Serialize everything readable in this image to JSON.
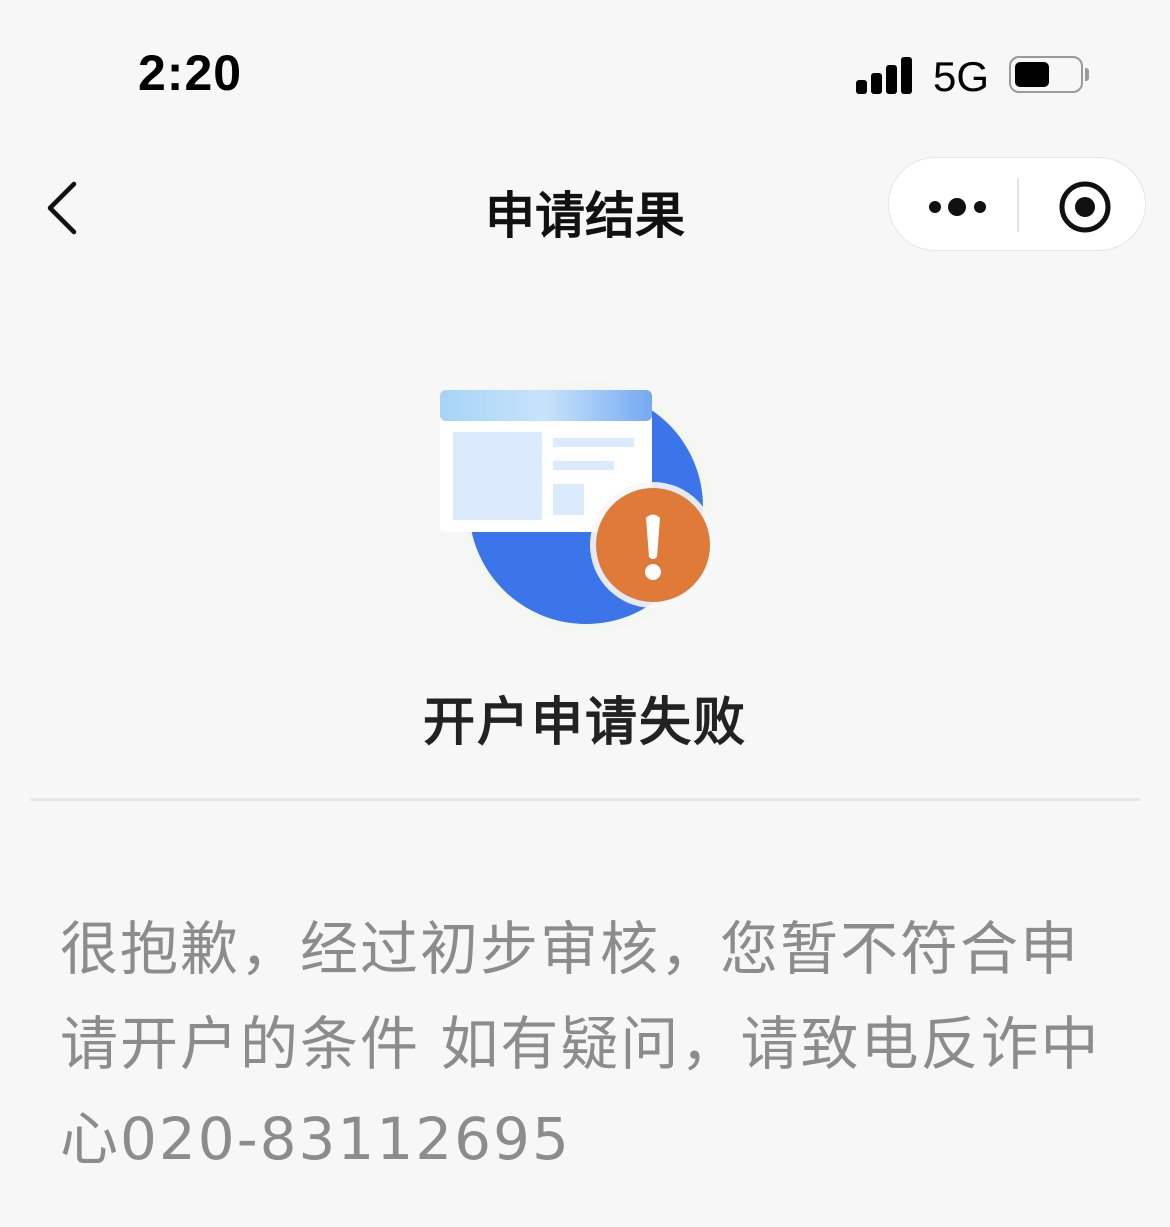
{
  "status_bar": {
    "time": "2:20",
    "network": "5G",
    "signal_bars": 4,
    "battery_level": 0.55
  },
  "nav": {
    "title": "申请结果",
    "back_icon": "chevron-left-icon",
    "more_icon": "more-dots-icon",
    "close_icon": "target-circle-icon"
  },
  "result": {
    "icon": "application-warning-icon",
    "title": "开户申请失败",
    "message": "很抱歉，经过初步审核，您暂不符合申\n请开户的条件 如有疑问，请致电反诈中\n心020-83112695"
  },
  "colors": {
    "background": "#f7f7f7",
    "accent_blue": "#3c74ea",
    "warning_orange": "#e07a38",
    "message_gray": "#8c8c8c"
  }
}
